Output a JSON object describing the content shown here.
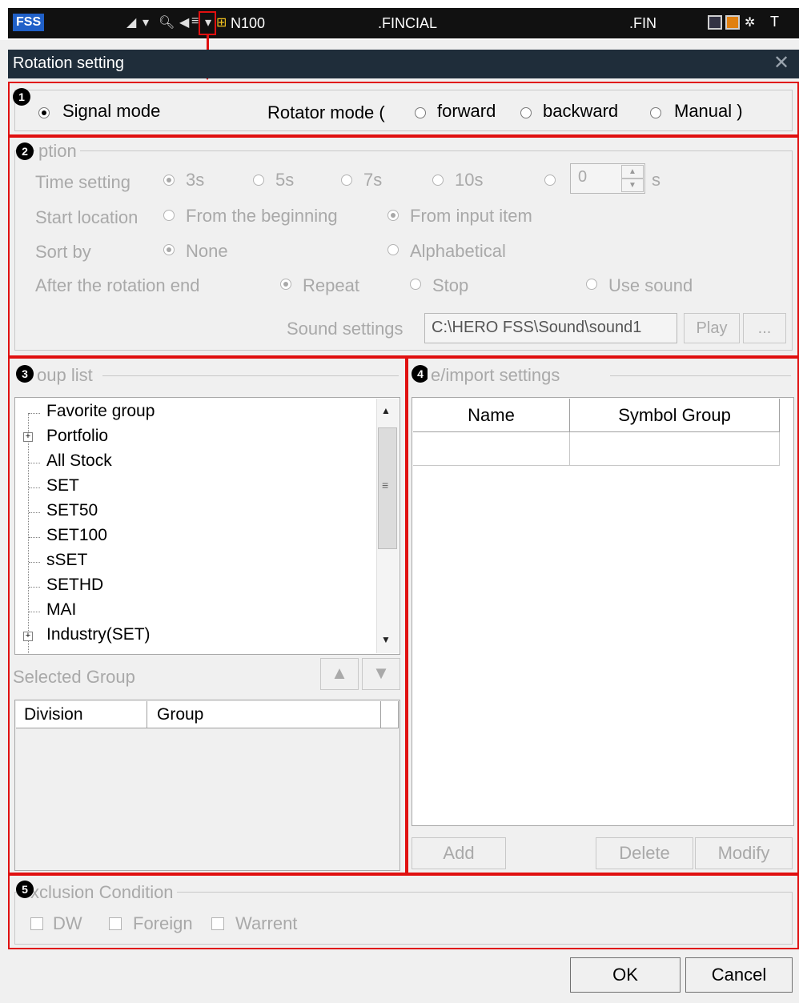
{
  "toolbar": {
    "logo": "FSS",
    "symbol_name": "N100",
    "fincial": ".FINCIAL",
    "fin": ".FIN",
    "right_t": "T"
  },
  "dialog": {
    "title": "Rotation setting",
    "close": "✕",
    "badges": [
      "1",
      "2",
      "3",
      "4",
      "5"
    ]
  },
  "mode": {
    "signal_mode": "Signal mode",
    "rotator_prefix": "Rotator mode (",
    "forward": "forward",
    "backward": "backward",
    "manual": "Manual )"
  },
  "option": {
    "legend": "ption",
    "time_setting": "Time setting",
    "times": [
      "3s",
      "5s",
      "7s",
      "10s"
    ],
    "custom_value": "0",
    "custom_unit": "s",
    "start_location": "Start location",
    "from_beginning": "From the beginning",
    "from_input": "From input item",
    "sort_by": "Sort by",
    "none": "None",
    "alphabetical": "Alphabetical",
    "after_end": "After the rotation end",
    "repeat": "Repeat",
    "stop": "Stop",
    "use_sound": "Use sound",
    "sound_settings": "Sound settings",
    "sound_path": "C:\\HERO FSS\\Sound\\sound1",
    "play": "Play",
    "browse": "..."
  },
  "group_list": {
    "legend": "oup list",
    "items": [
      "Favorite group",
      "Portfolio",
      "All Stock",
      "SET",
      "SET50",
      "SET100",
      "sSET",
      "SETHD",
      "MAI",
      "Industry(SET)"
    ],
    "selected_group": "Selected Group",
    "columns": [
      "Division",
      "Group"
    ]
  },
  "import": {
    "legend": "e/import settings",
    "columns": [
      "Name",
      "Symbol Group"
    ],
    "add": "Add",
    "delete": "Delete",
    "modify": "Modify"
  },
  "exclusion": {
    "legend": "xclusion Condition",
    "dw": "DW",
    "foreign": "Foreign",
    "warrent": "Warrent"
  },
  "footer": {
    "ok": "OK",
    "cancel": "Cancel"
  },
  "colors": {
    "highlight": "#e01010",
    "titlebar": "#1f2d3a",
    "disabled_text": "#a9a9a9"
  }
}
